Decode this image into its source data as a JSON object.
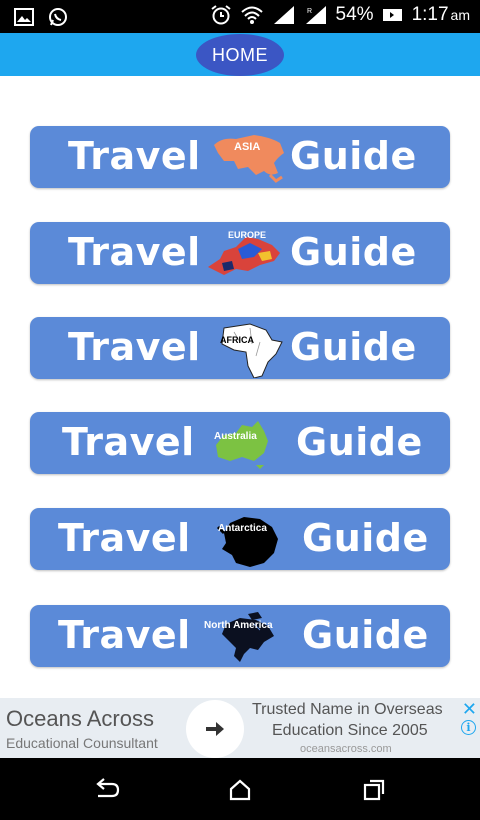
{
  "status_bar": {
    "battery": "54%",
    "time": "1:17",
    "ampm": "am"
  },
  "header": {
    "home_label": "HOME"
  },
  "guides": [
    {
      "left": "Travel",
      "right": "Guide",
      "region": "ASIA",
      "map_color": "#f08a5d"
    },
    {
      "left": "Travel",
      "right": "Guide",
      "region": "EUROPE",
      "map_color": "#d9433b"
    },
    {
      "left": "Travel",
      "right": "Guide",
      "region": "AFRICA",
      "map_color": "#ffffff"
    },
    {
      "left": "Travel",
      "right": "Guide",
      "region": "Australia",
      "map_color": "#7cc242"
    },
    {
      "left": "Travel",
      "right": "Guide",
      "region": "Antarctica",
      "map_color": "#000000"
    },
    {
      "left": "Travel",
      "right": "Guide",
      "region": "North America",
      "map_color": "#0b1020"
    }
  ],
  "ad": {
    "brand": "Oceans Across",
    "subtitle": "Educational Counsultant",
    "message_line1": "Trusted Name in Overseas",
    "message_line2": "Education Since 2005",
    "url": "oceansacross.com",
    "close": "✕",
    "info": "i"
  },
  "colors": {
    "header": "#1ea7ef",
    "home_button": "#3b56c4",
    "guide_button": "#5b8ad8"
  }
}
